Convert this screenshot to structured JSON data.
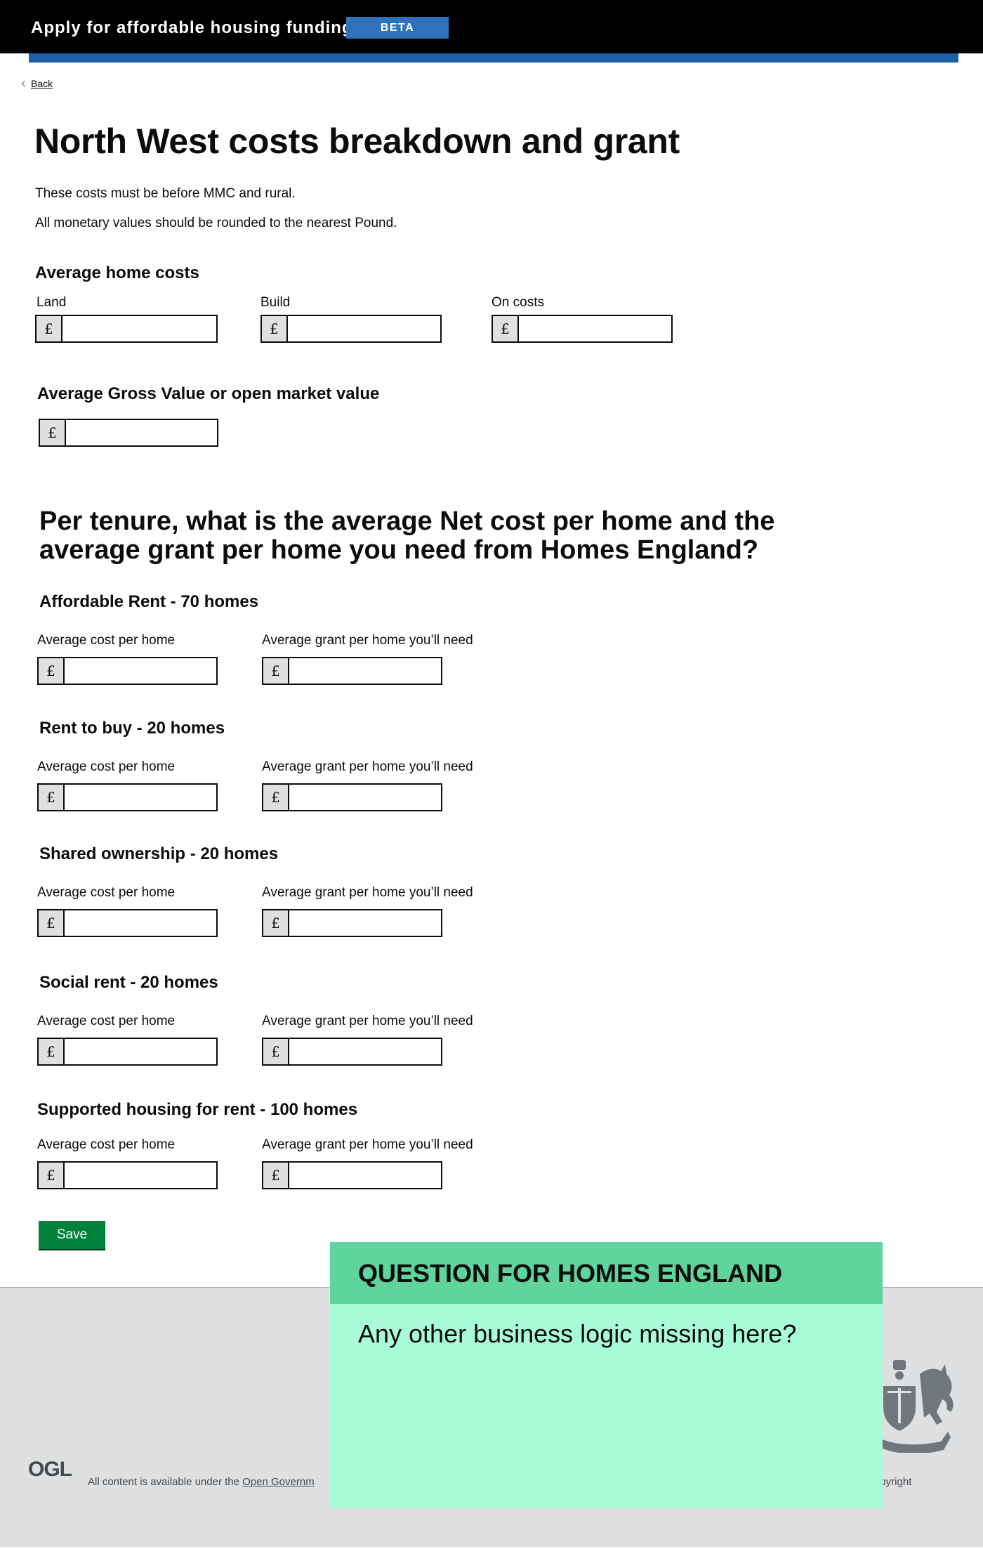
{
  "header": {
    "service_name": "Apply for affordable housing funding",
    "phase_tag": "BETA",
    "brand_color": "#1d5fa6",
    "tag_color": "#2f72bb"
  },
  "nav": {
    "back_label": "Back"
  },
  "page": {
    "title": "North West costs breakdown and grant",
    "intro_1": "These costs must be before MMC and rural.",
    "intro_2": "All monetary values should be rounded to the nearest Pound."
  },
  "currency_symbol": "£",
  "average_home_costs": {
    "heading": "Average home costs",
    "land_label": "Land",
    "build_label": "Build",
    "on_costs_label": "On costs",
    "land_value": "",
    "build_value": "",
    "on_costs_value": ""
  },
  "gross_value": {
    "heading": "Average Gross Value or open market value",
    "value": ""
  },
  "tenure": {
    "heading": "Per tenure, what is the average Net cost per home and the average grant per home you need from Homes England?",
    "cost_label": "Average cost per home",
    "grant_label": "Average grant per home you’ll need",
    "items": [
      {
        "heading": "Affordable Rent  - 70 homes",
        "cost_value": "",
        "grant_value": ""
      },
      {
        "heading": "Rent to buy - 20 homes",
        "cost_value": "",
        "grant_value": ""
      },
      {
        "heading": "Shared ownership - 20 homes",
        "cost_value": "",
        "grant_value": ""
      },
      {
        "heading": "Social rent - 20 homes",
        "cost_value": "",
        "grant_value": ""
      },
      {
        "heading": "Supported housing for rent  - 100 homes",
        "cost_value": "",
        "grant_value": ""
      }
    ]
  },
  "actions": {
    "save_label": "Save",
    "save_color": "#00823b"
  },
  "footer": {
    "ogl_logo": "OGL",
    "licence_prefix": "All content is available under the ",
    "licence_link": "Open Governm",
    "copyright_fragment": "opyright"
  },
  "annotation": {
    "title": "QUESTION FOR HOMES ENGLAND",
    "body": "Any other business logic missing here?",
    "header_color": "#5fd49d",
    "body_color": "#a8fdd8"
  }
}
